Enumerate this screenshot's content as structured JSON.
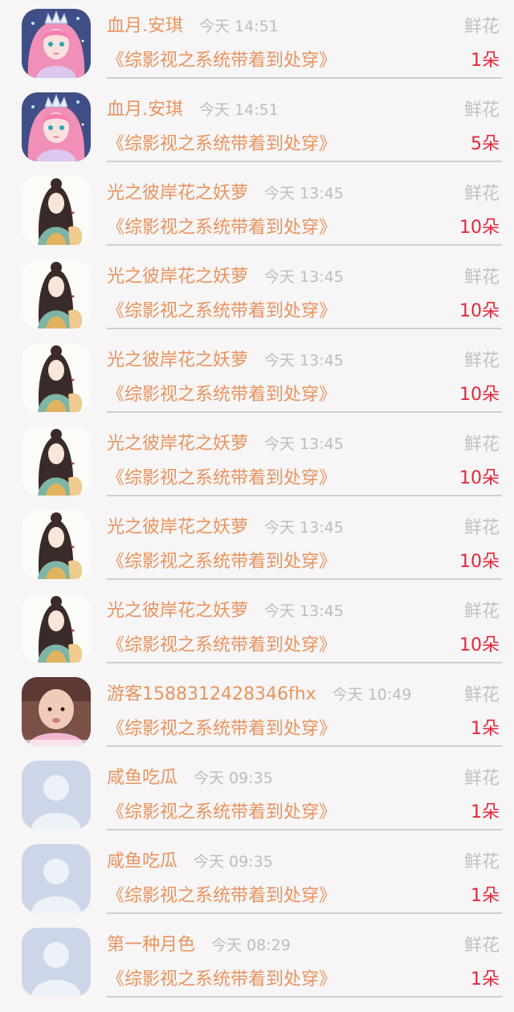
{
  "gifts": [
    {
      "name": "血月.安琪",
      "time": "今天 14:51",
      "label": "鲜花",
      "book": "《综影视之系统带着到处穿》",
      "amount": "1朵",
      "avatar": "princess-avatar"
    },
    {
      "name": "血月.安琪",
      "time": "今天 14:51",
      "label": "鲜花",
      "book": "《综影视之系统带着到处穿》",
      "amount": "5朵",
      "avatar": "princess-avatar"
    },
    {
      "name": "光之彼岸花之妖萝",
      "time": "今天 13:45",
      "label": "鲜花",
      "book": "《综影视之系统带着到处穿》",
      "amount": "10朵",
      "avatar": "ancient-lady-avatar"
    },
    {
      "name": "光之彼岸花之妖萝",
      "time": "今天 13:45",
      "label": "鲜花",
      "book": "《综影视之系统带着到处穿》",
      "amount": "10朵",
      "avatar": "ancient-lady-avatar"
    },
    {
      "name": "光之彼岸花之妖萝",
      "time": "今天 13:45",
      "label": "鲜花",
      "book": "《综影视之系统带着到处穿》",
      "amount": "10朵",
      "avatar": "ancient-lady-avatar"
    },
    {
      "name": "光之彼岸花之妖萝",
      "time": "今天 13:45",
      "label": "鲜花",
      "book": "《综影视之系统带着到处穿》",
      "amount": "10朵",
      "avatar": "ancient-lady-avatar"
    },
    {
      "name": "光之彼岸花之妖萝",
      "time": "今天 13:45",
      "label": "鲜花",
      "book": "《综影视之系统带着到处穿》",
      "amount": "10朵",
      "avatar": "ancient-lady-avatar"
    },
    {
      "name": "光之彼岸花之妖萝",
      "time": "今天 13:45",
      "label": "鲜花",
      "book": "《综影视之系统带着到处穿》",
      "amount": "10朵",
      "avatar": "ancient-lady-avatar"
    },
    {
      "name": "游客1588312428346fhx",
      "time": "今天 10:49",
      "label": "鲜花",
      "book": "《综影视之系统带着到处穿》",
      "amount": "1朵",
      "avatar": "baby-photo-avatar"
    },
    {
      "name": "咸鱼吃瓜",
      "time": "今天 09:35",
      "label": "鲜花",
      "book": "《综影视之系统带着到处穿》",
      "amount": "1朵",
      "avatar": "default-user-avatar"
    },
    {
      "name": "咸鱼吃瓜",
      "time": "今天 09:35",
      "label": "鲜花",
      "book": "《综影视之系统带着到处穿》",
      "amount": "1朵",
      "avatar": "default-user-avatar"
    },
    {
      "name": "第一种月色",
      "time": "今天 08:29",
      "label": "鲜花",
      "book": "《综影视之系统带着到处穿》",
      "amount": "1朵",
      "avatar": "default-user-avatar"
    }
  ],
  "colors": {
    "name": "#e8945e",
    "time": "#bdbdbd",
    "label": "#c2c2c2",
    "amount": "#e5273a",
    "divider": "#cfcfcf"
  }
}
